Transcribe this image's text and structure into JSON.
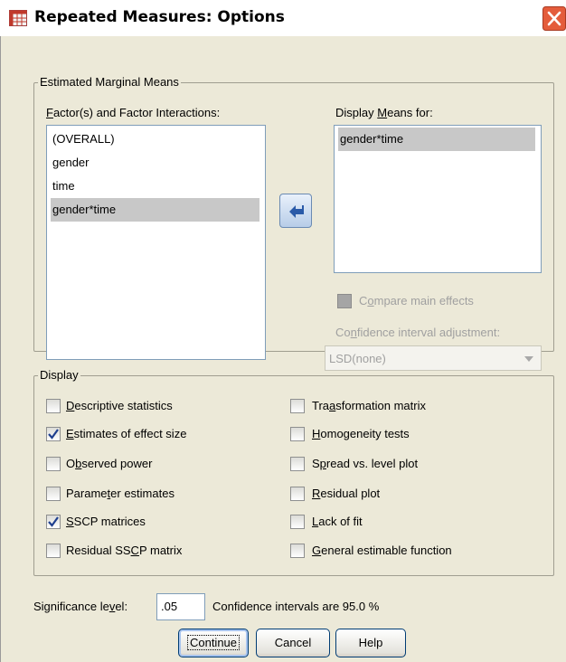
{
  "window": {
    "title": "Repeated Measures: Options"
  },
  "emm": {
    "legend": "Estimated Marginal Means",
    "factors_label": "Factor(s) and Factor Interactions:",
    "factors_items": [
      "(OVERALL)",
      "gender",
      "time",
      "gender*time"
    ],
    "factors_selected": "gender*time",
    "display_means_label": "Display Means for:",
    "display_means_items": [
      "gender*time"
    ],
    "compare_label": "Compare main effects",
    "ci_adjust_label": "Confidence interval adjustment:",
    "ci_adjust_value": "LSD(none)"
  },
  "display": {
    "legend": "Display",
    "left": [
      {
        "label": "Descriptive statistics",
        "checked": false
      },
      {
        "label": "Estimates of effect size",
        "checked": true
      },
      {
        "label": "Observed power",
        "checked": false
      },
      {
        "label": "Parameter estimates",
        "checked": false
      },
      {
        "label": "SSCP matrices",
        "checked": true
      },
      {
        "label": "Residual SSCP matrix",
        "checked": false
      }
    ],
    "right": [
      {
        "label": "Transformation matrix",
        "checked": false
      },
      {
        "label": "Homogeneity tests",
        "checked": false
      },
      {
        "label": "Spread vs. level plot",
        "checked": false
      },
      {
        "label": "Residual plot",
        "checked": false
      },
      {
        "label": "Lack of fit",
        "checked": false
      },
      {
        "label": "General estimable function",
        "checked": false
      }
    ]
  },
  "significance": {
    "label": "Significance level:",
    "value": ".05",
    "ci_text": "Confidence intervals are 95.0 %"
  },
  "buttons": {
    "continue": "Continue",
    "cancel": "Cancel",
    "help": "Help"
  },
  "colors": {
    "selection": "#c8c8c8",
    "dialog_bg": "#ece9d8",
    "close_red": "#e45c3b"
  },
  "icons": {
    "title": "spss-grid-icon",
    "close": "close-icon",
    "move": "arrow-left-icon",
    "check": "check-icon",
    "dropdown": "chevron-down-icon"
  }
}
